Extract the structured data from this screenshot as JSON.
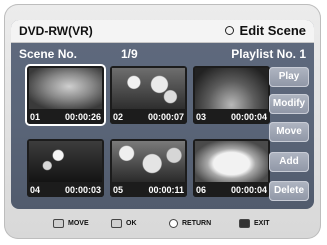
{
  "title": {
    "left": "DVD-RW(VR)",
    "right": "Edit Scene"
  },
  "header": {
    "scene_no_label": "Scene No.",
    "count": "1/9",
    "playlist_label": "Playlist No.  1"
  },
  "thumbs": [
    {
      "num": "01",
      "time": "00:00:26",
      "selected": true
    },
    {
      "num": "02",
      "time": "00:00:07"
    },
    {
      "num": "03",
      "time": "00:00:04"
    },
    {
      "num": "04",
      "time": "00:00:03"
    },
    {
      "num": "05",
      "time": "00:00:11"
    },
    {
      "num": "06",
      "time": "00:00:04"
    }
  ],
  "buttons": [
    "Play",
    "Modify",
    "Move",
    "Add",
    "Delete"
  ],
  "footer": {
    "move": "MOVE",
    "ok": "OK",
    "return": "RETURN",
    "exit": "EXIT"
  }
}
